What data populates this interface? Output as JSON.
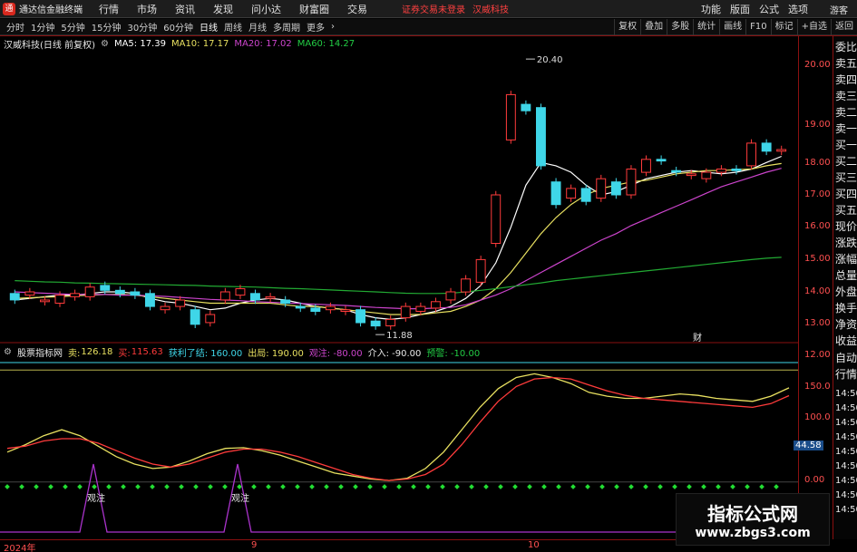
{
  "app": {
    "title": "通达信金融终端",
    "menu": [
      "行情",
      "市场",
      "资讯",
      "发现",
      "问小达",
      "财富圈",
      "交易"
    ],
    "notice": "证券交易未登录",
    "notice_stock": "汉威科技",
    "top_right": [
      "功能",
      "版面",
      "公式",
      "选项"
    ],
    "guest": "游客"
  },
  "periods": [
    "分时",
    "1分钟",
    "5分钟",
    "15分钟",
    "30分钟",
    "60分钟",
    "日线",
    "周线",
    "月线",
    "多周期",
    "更多"
  ],
  "active_period": "日线",
  "toolbar_right": [
    "复权",
    "叠加",
    "多股",
    "统计",
    "画线",
    "F10",
    "标记",
    "+自选",
    "返回"
  ],
  "main_info": {
    "stock": "汉威科技(日线 前复权)",
    "ma5": "MA5: 17.39",
    "ma10": "MA10: 17.17",
    "ma20": "MA20: 17.02",
    "ma60": "MA60: 14.27"
  },
  "price_axis": [
    "20.00",
    "19.00",
    "18.00",
    "17.00",
    "16.00",
    "15.00",
    "14.00",
    "13.00",
    "12.00"
  ],
  "price_marks": {
    "high": "20.40",
    "low": "11.88",
    "flag": "财"
  },
  "sub_info": {
    "name": "股票指标网",
    "sell_label": "卖:",
    "sell": "126.18",
    "buy_label": "买:",
    "buy": "115.63",
    "profit": "获利了结: 160.00",
    "exit": "出局: 190.00",
    "watch": "观注: -80.00",
    "enter": "介入: -90.00",
    "alert": "预警: -10.00"
  },
  "sub_axis": [
    "150.0",
    "100.0",
    "0.00"
  ],
  "sub_right": [
    "14:50",
    "14:50",
    "14:50",
    "14:50",
    "14:50",
    "14:50",
    "14:50",
    "14:50",
    "14:50"
  ],
  "sub_current": "44.58",
  "sub_marks": [
    "观注",
    "观注"
  ],
  "right_panel": [
    "委比",
    "卖五",
    "卖四",
    "卖三",
    "卖二",
    "卖一",
    "买一",
    "买二",
    "买三",
    "买四",
    "买五",
    "现价",
    "涨跌",
    "涨幅",
    "总量",
    "外盘",
    "换手",
    "净资",
    "收益",
    "自动",
    "行情"
  ],
  "dates": [
    "2024年",
    "9",
    "10"
  ],
  "watermark": {
    "title": "指标公式网",
    "url": "www.zbgs3.com"
  },
  "colors": {
    "up": "#ff3b3b",
    "down": "#3fd6e8",
    "ma5": "#ffffff",
    "ma10": "#e8e060",
    "ma20": "#cc44cc",
    "ma60": "#22aa33"
  },
  "chart_data": {
    "type": "candlestick",
    "y_range": [
      11.8,
      20.6
    ],
    "candles": [
      {
        "o": 13.15,
        "c": 12.95
      },
      {
        "o": 13.1,
        "c": 13.2
      },
      {
        "o": 12.9,
        "c": 12.95
      },
      {
        "o": 12.85,
        "c": 13.1
      },
      {
        "o": 13.05,
        "c": 13.15
      },
      {
        "o": 13.05,
        "c": 13.35
      },
      {
        "o": 13.4,
        "c": 13.25
      },
      {
        "o": 13.25,
        "c": 13.15
      },
      {
        "o": 13.2,
        "c": 13.1
      },
      {
        "o": 13.15,
        "c": 12.75
      },
      {
        "o": 12.65,
        "c": 12.75
      },
      {
        "o": 12.75,
        "c": 12.95
      },
      {
        "o": 12.65,
        "c": 12.2
      },
      {
        "o": 12.25,
        "c": 12.5
      },
      {
        "o": 12.95,
        "c": 13.2
      },
      {
        "o": 13.1,
        "c": 13.3
      },
      {
        "o": 13.15,
        "c": 12.95
      },
      {
        "o": 13.0,
        "c": 13.05
      },
      {
        "o": 12.95,
        "c": 12.85
      },
      {
        "o": 12.75,
        "c": 12.7
      },
      {
        "o": 12.7,
        "c": 12.6
      },
      {
        "o": 12.65,
        "c": 12.75
      },
      {
        "o": 12.6,
        "c": 12.65
      },
      {
        "o": 12.65,
        "c": 12.25
      },
      {
        "o": 12.3,
        "c": 12.15
      },
      {
        "o": 12.15,
        "c": 12.35
      },
      {
        "o": 12.4,
        "c": 12.75
      },
      {
        "o": 12.6,
        "c": 12.75
      },
      {
        "o": 12.7,
        "c": 12.9
      },
      {
        "o": 12.95,
        "c": 13.2
      },
      {
        "o": 13.2,
        "c": 13.6
      },
      {
        "o": 13.5,
        "c": 14.2
      },
      {
        "o": 14.7,
        "c": 16.2
      },
      {
        "o": 17.9,
        "c": 19.3
      },
      {
        "o": 19.0,
        "c": 18.8
      },
      {
        "o": 18.9,
        "c": 17.1
      },
      {
        "o": 16.6,
        "c": 15.9
      },
      {
        "o": 16.1,
        "c": 16.4
      },
      {
        "o": 16.4,
        "c": 16.0
      },
      {
        "o": 16.1,
        "c": 16.7
      },
      {
        "o": 16.6,
        "c": 16.2
      },
      {
        "o": 16.2,
        "c": 17.0
      },
      {
        "o": 16.9,
        "c": 17.3
      },
      {
        "o": 17.3,
        "c": 17.25
      },
      {
        "o": 16.95,
        "c": 16.9
      },
      {
        "o": 16.8,
        "c": 16.85
      },
      {
        "o": 16.7,
        "c": 16.9
      },
      {
        "o": 16.9,
        "c": 17.0
      },
      {
        "o": 17.0,
        "c": 16.95
      },
      {
        "o": 17.1,
        "c": 17.8
      },
      {
        "o": 17.8,
        "c": 17.55
      },
      {
        "o": 17.55,
        "c": 17.6
      }
    ],
    "ma_series": [
      {
        "name": "MA5",
        "values": [
          12.95,
          13.0,
          13.05,
          13.1,
          13.1,
          13.15,
          13.2,
          13.2,
          13.15,
          13.0,
          12.9,
          12.85,
          12.75,
          12.65,
          12.7,
          12.85,
          12.95,
          13.0,
          12.95,
          12.85,
          12.75,
          12.7,
          12.65,
          12.5,
          12.4,
          12.35,
          12.4,
          12.5,
          12.6,
          12.75,
          13.0,
          13.4,
          14.1,
          15.2,
          16.5,
          17.2,
          17.1,
          16.9,
          16.5,
          16.2,
          16.3,
          16.5,
          16.7,
          16.8,
          16.9,
          16.95,
          16.9,
          16.85,
          16.9,
          17.0,
          17.2,
          17.39
        ]
      },
      {
        "name": "MA10",
        "values": [
          13.0,
          13.02,
          13.04,
          13.05,
          13.08,
          13.1,
          13.12,
          13.12,
          13.1,
          13.05,
          13.0,
          12.95,
          12.9,
          12.85,
          12.85,
          12.85,
          12.85,
          12.85,
          12.8,
          12.75,
          12.75,
          12.7,
          12.65,
          12.6,
          12.55,
          12.5,
          12.5,
          12.5,
          12.55,
          12.6,
          12.75,
          12.95,
          13.3,
          13.8,
          14.4,
          15.0,
          15.5,
          15.9,
          16.2,
          16.4,
          16.5,
          16.6,
          16.65,
          16.75,
          16.85,
          16.9,
          16.95,
          16.95,
          16.98,
          17.0,
          17.1,
          17.17
        ]
      },
      {
        "name": "MA20",
        "values": [
          13.2,
          13.18,
          13.16,
          13.14,
          13.12,
          13.12,
          13.12,
          13.1,
          13.1,
          13.08,
          13.06,
          13.03,
          13.0,
          12.97,
          12.95,
          12.93,
          12.9,
          12.88,
          12.86,
          12.84,
          12.82,
          12.8,
          12.78,
          12.75,
          12.72,
          12.7,
          12.68,
          12.68,
          12.7,
          12.72,
          12.8,
          12.95,
          13.1,
          13.3,
          13.55,
          13.8,
          14.05,
          14.3,
          14.55,
          14.8,
          15.0,
          15.25,
          15.45,
          15.65,
          15.85,
          16.05,
          16.25,
          16.45,
          16.6,
          16.75,
          16.9,
          17.02
        ]
      },
      {
        "name": "MA60",
        "values": [
          13.55,
          13.53,
          13.51,
          13.5,
          13.48,
          13.47,
          13.46,
          13.45,
          13.44,
          13.43,
          13.42,
          13.41,
          13.4,
          13.38,
          13.37,
          13.36,
          13.35,
          13.33,
          13.31,
          13.3,
          13.28,
          13.26,
          13.24,
          13.22,
          13.2,
          13.18,
          13.16,
          13.15,
          13.15,
          13.16,
          13.2,
          13.25,
          13.3,
          13.36,
          13.42,
          13.48,
          13.55,
          13.6,
          13.65,
          13.7,
          13.75,
          13.8,
          13.85,
          13.9,
          13.95,
          14.0,
          14.05,
          14.1,
          14.15,
          14.2,
          14.24,
          14.27
        ]
      }
    ],
    "sub_range": [
      -10,
      160
    ],
    "sub_series": [
      {
        "name": "卖",
        "values": [
          40,
          50,
          62,
          70,
          62,
          48,
          34,
          24,
          18,
          20,
          28,
          38,
          45,
          46,
          42,
          36,
          28,
          20,
          12,
          8,
          4,
          2,
          5,
          18,
          40,
          70,
          100,
          125,
          140,
          145,
          140,
          132,
          120,
          115,
          112,
          112,
          115,
          118,
          116,
          112,
          110,
          108,
          115,
          126.18
        ]
      },
      {
        "name": "买",
        "values": [
          45,
          48,
          55,
          58,
          58,
          52,
          42,
          32,
          24,
          20,
          24,
          32,
          40,
          44,
          44,
          40,
          34,
          26,
          18,
          10,
          5,
          2,
          4,
          10,
          24,
          50,
          80,
          108,
          128,
          138,
          140,
          138,
          130,
          122,
          116,
          112,
          110,
          108,
          106,
          104,
          102,
          100,
          105,
          115.63
        ]
      }
    ]
  }
}
